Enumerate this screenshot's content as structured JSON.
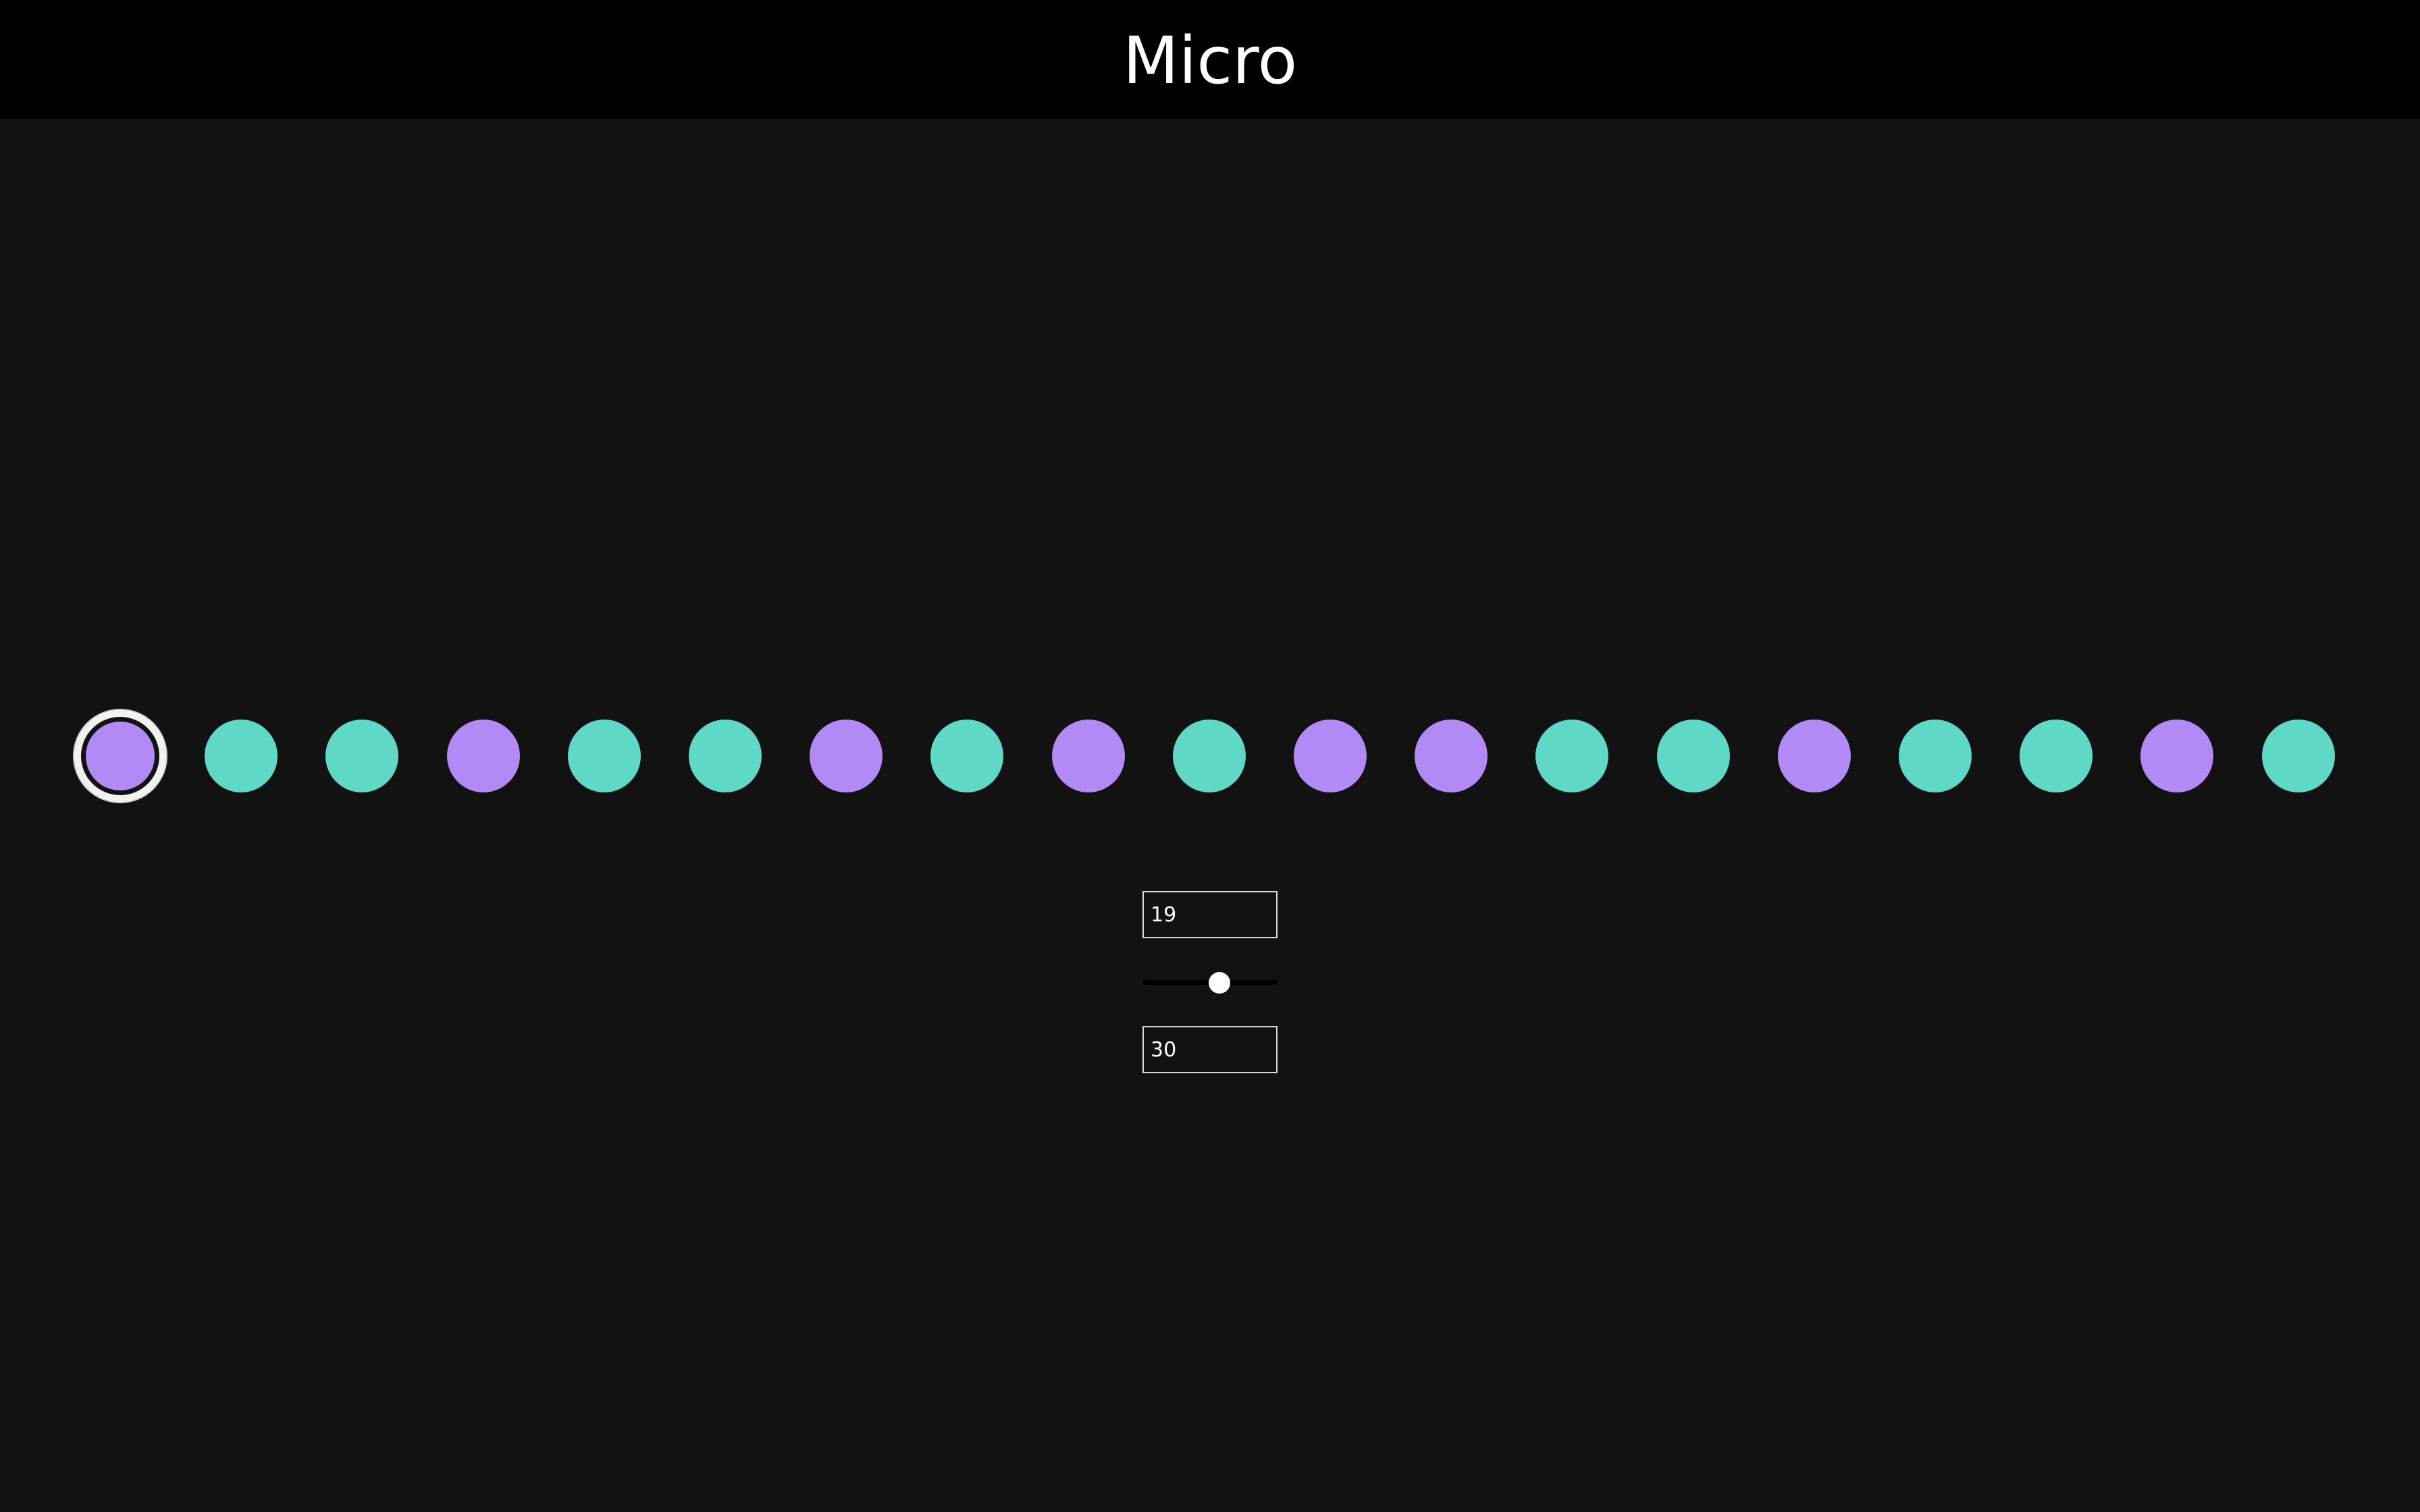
{
  "header": {
    "title": "Micro"
  },
  "colors": {
    "purple": "#b28af5",
    "teal": "#5fd8c5",
    "header_bg": "#000000",
    "page_bg": "#121212"
  },
  "dots": {
    "sequence": [
      "purple",
      "teal",
      "teal",
      "purple",
      "teal",
      "teal",
      "purple",
      "teal",
      "purple",
      "teal",
      "purple",
      "purple",
      "teal",
      "teal",
      "purple",
      "teal",
      "teal",
      "purple",
      "teal"
    ],
    "selected_index": 0
  },
  "controls": {
    "count_value": "19",
    "slider_fraction": 0.57,
    "speed_value": "30"
  }
}
